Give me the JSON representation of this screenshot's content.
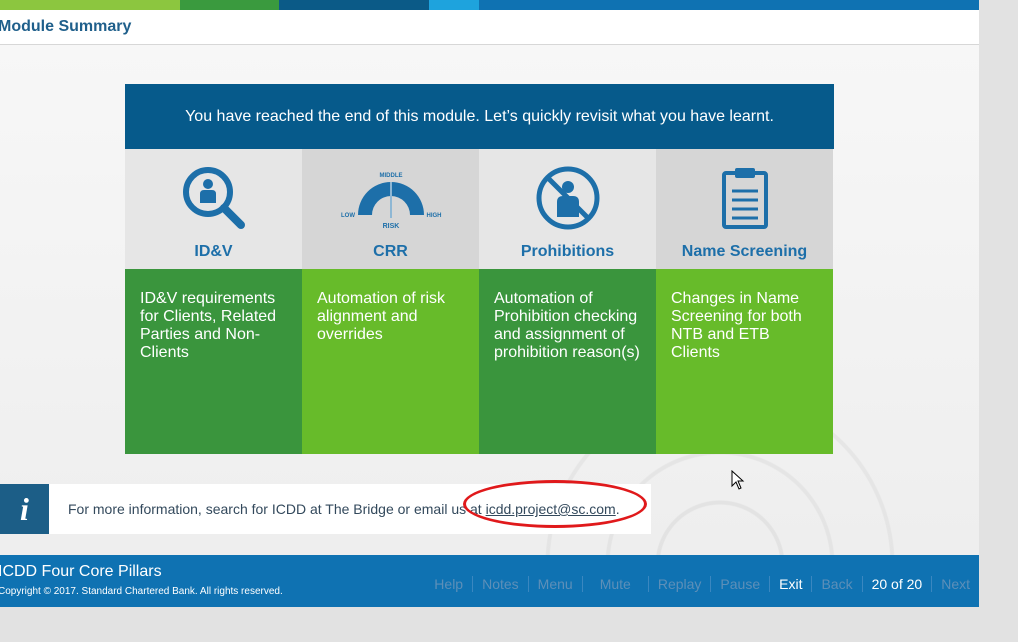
{
  "header": {
    "title": "Module Summary"
  },
  "topbar_colors": [
    "#8cc63f",
    "#3a9a3e",
    "#0b5a87",
    "#1ea3dd",
    "#0f72b2"
  ],
  "summary": {
    "heading": "You have reached the end of this module. Let’s quickly revisit what you have learnt.",
    "pillars": [
      {
        "icon": "magnifier-person-icon",
        "label": "ID&V",
        "description": "ID&V requirements for Clients, Related Parties and Non-Clients"
      },
      {
        "icon": "risk-gauge-icon",
        "label": "CRR",
        "description": "Automation of risk alignment and overrides",
        "gauge": {
          "low": "LOW",
          "middle": "MIDDLE",
          "high": "HIGH",
          "risk": "RISK"
        }
      },
      {
        "icon": "prohibited-person-icon",
        "label": "Prohibitions",
        "description": "Automation of Prohibition checking and assignment of prohibition reason(s)"
      },
      {
        "icon": "clipboard-icon",
        "label": "Name Screening",
        "description": "Changes in Name Screening for both NTB and ETB Clients"
      }
    ]
  },
  "info": {
    "icon": "i",
    "text": "For more information, search for ICDD at The Bridge or email us at ",
    "email": "icdd.project@sc.com",
    "suffix": "."
  },
  "footer": {
    "course_title": "ICDD Four Core Pillars",
    "copyright": "Copyright © 2017. Standard Chartered Bank. All rights reserved.",
    "nav": {
      "help": "Help",
      "notes": "Notes",
      "menu": "Menu",
      "mute": "Mute",
      "replay": "Replay",
      "pause": "Pause",
      "exit": "Exit",
      "back": "Back",
      "counter": "20 of 20",
      "next": "Next"
    }
  }
}
